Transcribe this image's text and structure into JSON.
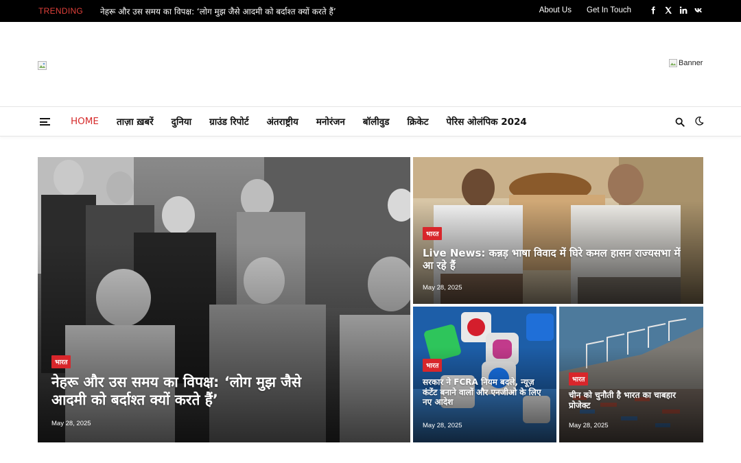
{
  "topbar": {
    "trending_label": "TRENDING",
    "trending_headline": "नेहरू और उस समय का विपक्ष: ‘लोग मुझ जैसे आदमी को बर्दाश्त क्यों करते हैं’",
    "links": [
      "About Us",
      "Get In Touch"
    ],
    "social": [
      "facebook-icon",
      "x-icon",
      "linkedin-icon",
      "vk-icon"
    ]
  },
  "header": {
    "banner_alt": "Banner"
  },
  "nav": {
    "items": [
      "HOME",
      "ताज़ा ख़बरें",
      "दुनिया",
      "ग्राउंड रिपोर्ट",
      "अंतराष्ट्रीय",
      "मनोरंजन",
      "बॉलीवुड",
      "क्रिकेट",
      "पेरिस ओलंपिक 2024"
    ],
    "active_index": 0,
    "accent_color": "#d62b2b"
  },
  "posts": {
    "main": {
      "category": "भारत",
      "title": "नेहरू और उस समय का विपक्ष: ‘लोग मुझ जैसे आदमी को बर्दाश्त क्यों करते हैं’",
      "date": "May 28, 2025"
    },
    "top": {
      "category": "भारत",
      "title": "Live News: कन्नड़ भाषा विवाद में घिरे कमल हासन राज्यसभा में आ रहे हैं",
      "date": "May 28, 2025"
    },
    "bottom_left": {
      "category": "भारत",
      "title": "सरकार ने FCRA नियम बदले, न्यूज़ कंटेंट बनाने वालों और एनजीओ के लिए नए आदेश",
      "date": "May 28, 2025"
    },
    "bottom_right": {
      "category": "भारत",
      "title": "चीन को चुनौती है भारत का चाबहार प्रोजेक्ट",
      "date": "May 28, 2025"
    }
  },
  "colors": {
    "badge": "#d8262b",
    "topbar_bg": "#000000"
  }
}
